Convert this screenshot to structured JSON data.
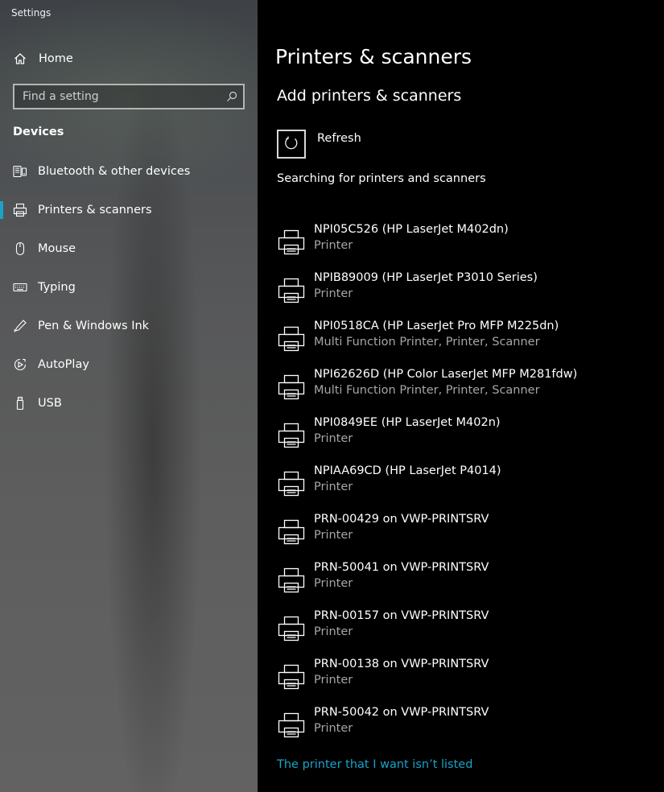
{
  "app": {
    "title": "Settings"
  },
  "sidebar": {
    "home_label": "Home",
    "search_placeholder": "Find a setting",
    "section_title": "Devices",
    "items": [
      {
        "label": "Bluetooth & other devices",
        "icon": "bluetooth-devices-icon"
      },
      {
        "label": "Printers & scanners",
        "icon": "printer-icon",
        "active": true
      },
      {
        "label": "Mouse",
        "icon": "mouse-icon"
      },
      {
        "label": "Typing",
        "icon": "keyboard-icon"
      },
      {
        "label": "Pen & Windows Ink",
        "icon": "pen-icon"
      },
      {
        "label": "AutoPlay",
        "icon": "autoplay-icon"
      },
      {
        "label": "USB",
        "icon": "usb-icon"
      }
    ]
  },
  "main": {
    "title": "Printers & scanners",
    "add_section_title": "Add printers & scanners",
    "refresh_label": "Refresh",
    "searching_text": "Searching for printers and scanners",
    "printers": [
      {
        "name": "NPI05C526 (HP LaserJet M402dn)",
        "type": "Printer"
      },
      {
        "name": "NPIB89009 (HP LaserJet P3010 Series)",
        "type": "Printer"
      },
      {
        "name": "NPI0518CA (HP LaserJet Pro MFP M225dn)",
        "type": "Multi Function Printer, Printer, Scanner"
      },
      {
        "name": "NPI62626D (HP Color LaserJet MFP M281fdw)",
        "type": "Multi Function Printer, Printer, Scanner"
      },
      {
        "name": "NPI0849EE (HP LaserJet M402n)",
        "type": "Printer"
      },
      {
        "name": "NPIAA69CD (HP LaserJet P4014)",
        "type": "Printer"
      },
      {
        "name": "PRN-00429 on VWP-PRINTSRV",
        "type": "Printer"
      },
      {
        "name": "PRN-50041 on VWP-PRINTSRV",
        "type": "Printer"
      },
      {
        "name": "PRN-00157 on VWP-PRINTSRV",
        "type": "Printer"
      },
      {
        "name": "PRN-00138 on VWP-PRINTSRV",
        "type": "Printer"
      },
      {
        "name": "PRN-50042 on VWP-PRINTSRV",
        "type": "Printer"
      }
    ],
    "not_listed_link": "The printer that I want isn’t listed"
  },
  "colors": {
    "accent": "#1aa3c7",
    "secondary_text": "#a6a6a6",
    "main_background": "#000000"
  }
}
